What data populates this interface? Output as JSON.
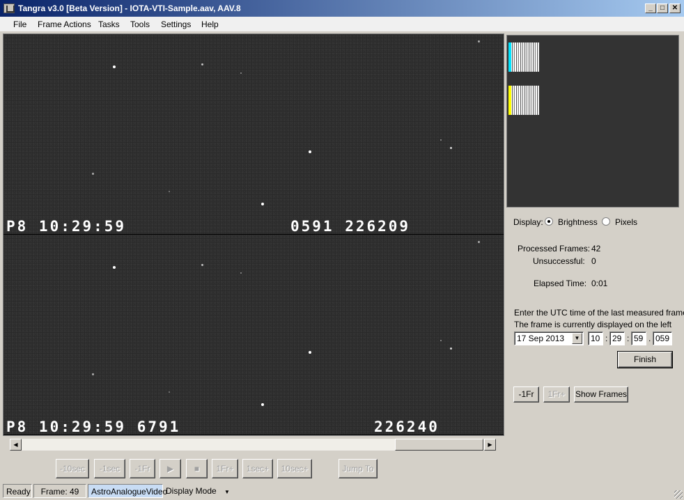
{
  "window": {
    "title": "Tangra v3.0 [Beta Version] - IOTA-VTI-Sample.aav, AAV.8",
    "minimize": "_",
    "maximize": "□",
    "close": "✕"
  },
  "menu": [
    "File",
    "Frame Actions",
    "Tasks",
    "Tools",
    "Settings",
    "Help"
  ],
  "video": {
    "top_osd_left": "P8 10:29:59",
    "top_osd_right": "0591 226209",
    "bottom_osd_left": "P8 10:29:59 6791",
    "bottom_osd_right": "226240"
  },
  "panel": {
    "display_label": "Display:",
    "opt_brightness": "Brightness",
    "opt_pixels": "Pixels",
    "selected_display": "Brightness",
    "processed_label": "Processed Frames:",
    "processed_value": "42",
    "unsuccessful_label": "Unsuccessful:",
    "unsuccessful_value": "0",
    "elapsed_label": "Elapsed Time:",
    "elapsed_value": "0:01",
    "utc_prompt_1": "Enter the UTC time of the last measured frame:",
    "utc_prompt_2": "The frame is currently displayed on the left",
    "date_value": "17 Sep 2013",
    "hour": "10",
    "minute": "29",
    "second": "59",
    "ms": "059",
    "sep_colon": ":",
    "sep_dot": ".",
    "finish_label": "Finish",
    "prev_frame_label": "-1Fr",
    "next_frame_label": "1Fr+",
    "show_frames_label": "Show Frames"
  },
  "transport": {
    "back10": "-10sec",
    "back1": "-1sec",
    "backfr": "-1Fr",
    "fwdfr": "1Fr+",
    "fwd1": "1sec+",
    "fwd10": "10sec+",
    "jump": "Jump To"
  },
  "status": {
    "state": "Ready",
    "frame": "Frame: 49",
    "mode_engine": "AstroAnalogueVideo",
    "display_mode": "Display Mode"
  },
  "colors": {
    "title_start": "#0a246a",
    "title_end": "#a6caf0",
    "cyan_marker": "#00e5ff",
    "yellow_marker": "#ffff00",
    "engine_highlight": "#c8dcf4"
  }
}
